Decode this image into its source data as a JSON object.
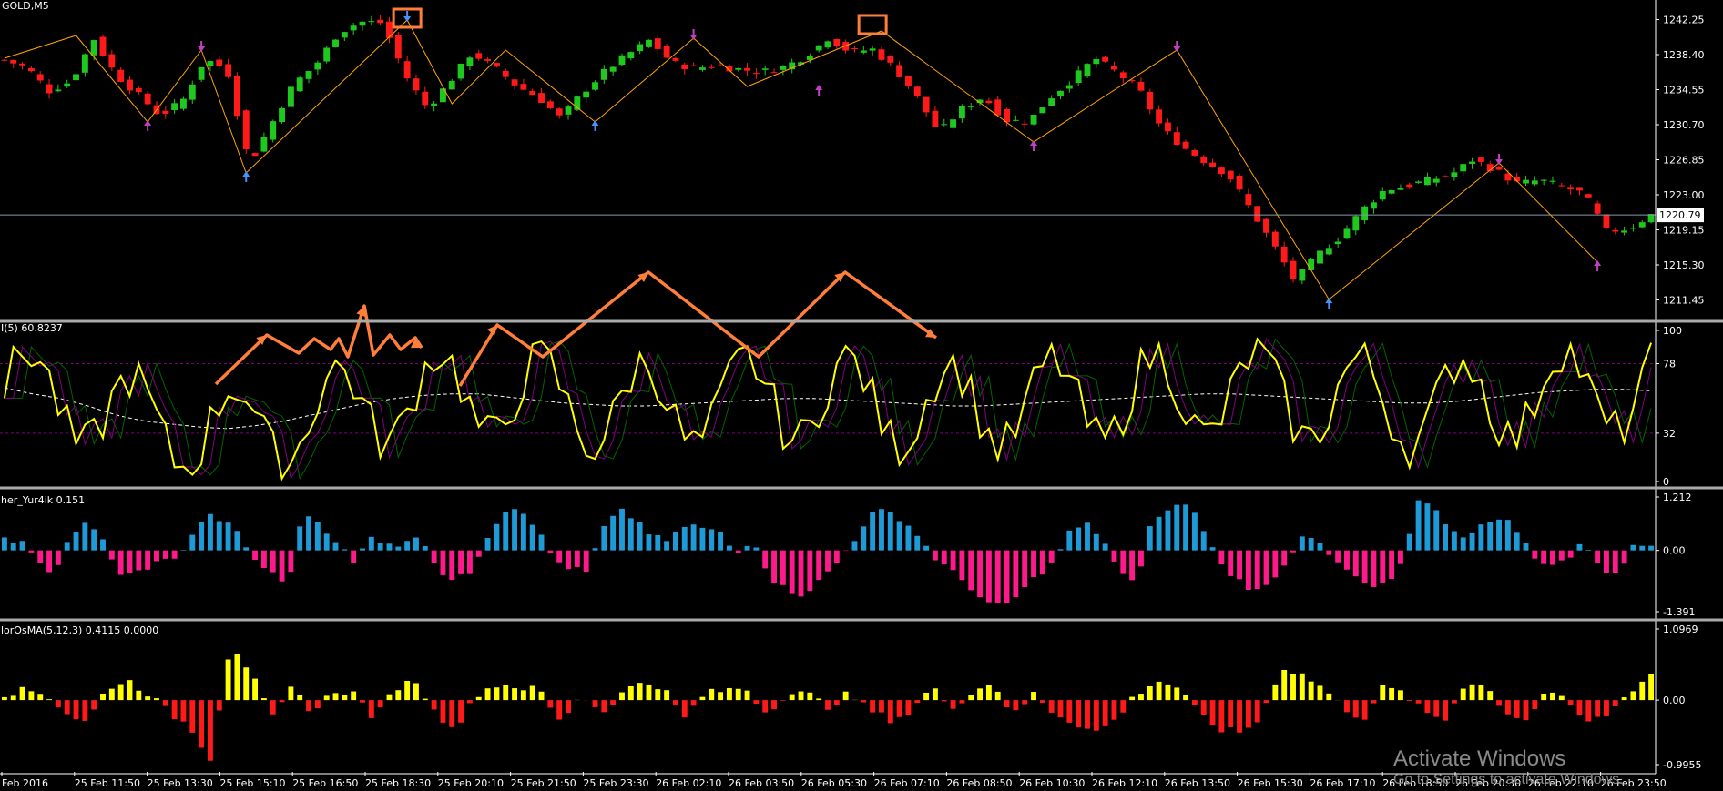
{
  "symbol_label": "GOLD,M5",
  "colors": {
    "background": "#000000",
    "bull": "#1ec81e",
    "bear": "#ff1a1a",
    "zigzag": "#ffa500",
    "rsi_line": "#ffff00",
    "rsi_avg": "#ffffff",
    "fisher_pos": "#1e9bd7",
    "fisher_neg": "#ff1a8c",
    "osma_pos": "#ffff00",
    "osma_neg": "#ff1a1a",
    "arrows": "#ff7f3a",
    "level_line": "#800080"
  },
  "current_price": "1220.79",
  "watermark": {
    "line1": "Activate Windows",
    "line2": "Go to Settings to activate Windows."
  },
  "chart_data": [
    {
      "type": "candlestick",
      "title": "",
      "y_ticks": [
        "1242.25",
        "1238.40",
        "1234.55",
        "1230.70",
        "1226.85",
        "1223.00",
        "1219.15",
        "1215.30",
        "1211.45"
      ],
      "ylim": [
        1209.6,
        1244.0
      ],
      "close_series": [
        1237.8,
        1237.0,
        1234.4,
        1235.5,
        1240.2,
        1236.2,
        1234.0,
        1231.7,
        1233.3,
        1237.9,
        1236.8,
        1226.4,
        1230.8,
        1235.2,
        1237.3,
        1240.8,
        1242.0,
        1241.9,
        1236.2,
        1232.5,
        1235.4,
        1238.6,
        1237.0,
        1235.0,
        1233.7,
        1231.4,
        1234.3,
        1236.6,
        1238.4,
        1240.0,
        1237.5,
        1236.9,
        1237.2,
        1236.8,
        1236.5,
        1237.0,
        1238.2,
        1240.2,
        1238.7,
        1239.0,
        1236.9,
        1233.8,
        1229.8,
        1232.4,
        1233.8,
        1231.2,
        1231.0,
        1233.7,
        1235.7,
        1238.0,
        1236.4,
        1234.5,
        1230.3,
        1228.2,
        1226.6,
        1225.2,
        1221.4,
        1217.6,
        1213.5,
        1216.4,
        1218.3,
        1221.3,
        1223.5,
        1224.0,
        1224.6,
        1225.2,
        1226.9,
        1225.7,
        1224.2,
        1224.6,
        1223.9,
        1223.1,
        1219.0,
        1219.3,
        1220.8
      ],
      "zigzag": [
        [
          0,
          1238.0
        ],
        [
          8,
          1240.5
        ],
        [
          16,
          1231.0
        ],
        [
          22,
          1238.9
        ],
        [
          27,
          1225.4
        ],
        [
          45,
          1242.2
        ],
        [
          50,
          1233.0
        ],
        [
          56,
          1238.9
        ],
        [
          66,
          1231.0
        ],
        [
          77,
          1240.2
        ],
        [
          83,
          1234.9
        ],
        [
          98,
          1241.0
        ],
        [
          115,
          1228.8
        ],
        [
          124,
          1234.5
        ],
        [
          131,
          1238.9
        ],
        [
          148,
          1211.5
        ],
        [
          167,
          1226.5
        ],
        [
          178,
          1215.6
        ]
      ],
      "swing_markers": [
        {
          "i": 16,
          "v": 1231.0,
          "side": "low",
          "color": "#c040c0"
        },
        {
          "i": 22,
          "v": 1238.9,
          "side": "high",
          "color": "#c040c0"
        },
        {
          "i": 27,
          "v": 1225.4,
          "side": "low",
          "color": "#4a90ff"
        },
        {
          "i": 45,
          "v": 1242.2,
          "side": "high",
          "color": "#4a90ff"
        },
        {
          "i": 66,
          "v": 1231.0,
          "side": "low",
          "color": "#4a90ff"
        },
        {
          "i": 77,
          "v": 1240.2,
          "side": "high",
          "color": "#c040c0"
        },
        {
          "i": 91,
          "v": 1234.9,
          "side": "low",
          "color": "#c040c0"
        },
        {
          "i": 115,
          "v": 1228.8,
          "side": "low",
          "color": "#c040c0"
        },
        {
          "i": 131,
          "v": 1238.9,
          "side": "high",
          "color": "#c040c0"
        },
        {
          "i": 148,
          "v": 1211.5,
          "side": "low",
          "color": "#4a90ff"
        },
        {
          "i": 167,
          "v": 1226.5,
          "side": "high",
          "color": "#c040c0"
        },
        {
          "i": 178,
          "v": 1215.6,
          "side": "low",
          "color": "#c040c0"
        }
      ],
      "highlight_boxes": [
        {
          "i": 45,
          "v": 1242.2
        },
        {
          "i": 97,
          "v": 1241.5
        }
      ]
    },
    {
      "type": "line",
      "title": "I(5) 60.8237",
      "y_ticks": [
        "100",
        "78",
        "32",
        "0"
      ],
      "ylim": [
        0,
        100
      ],
      "levels": [
        78,
        32
      ],
      "series": [
        {
          "values": [
            62,
            58,
            55,
            50,
            44,
            40,
            38,
            36,
            35,
            37,
            40,
            44,
            48,
            52,
            55,
            57,
            58,
            58,
            56,
            54,
            52,
            51,
            50,
            50,
            51,
            52,
            53,
            54,
            55,
            55,
            54,
            53,
            52,
            51,
            50,
            50,
            51,
            52,
            53,
            54,
            55,
            56,
            57,
            58,
            58,
            57,
            56,
            55,
            54,
            53,
            52,
            52,
            53,
            55,
            57,
            59,
            60,
            61,
            61,
            60
          ]
        }
      ]
    },
    {
      "type": "bar",
      "title": "her_Yur4ik 0.151",
      "y_ticks": [
        "1.212",
        "0.00",
        "-1.391"
      ],
      "ylim": [
        -1.391,
        1.212
      ],
      "values": [
        0.3,
        0.2,
        -0.3,
        -0.5,
        0.4,
        0.6,
        0.2,
        -0.6,
        -0.5,
        -0.3,
        -0.2,
        0.1,
        0.8,
        0.7,
        0.4,
        -0.2,
        -0.5,
        -0.8,
        0.9,
        0.6,
        0.2,
        -0.3,
        0.3,
        0.2,
        0.1,
        0.4,
        -0.4,
        -0.7,
        -0.5,
        0.3,
        0.9,
        1.0,
        0.5,
        -0.2,
        -0.4,
        -0.5,
        0.5,
        0.9,
        0.7,
        0.3,
        0.2,
        0.6,
        0.5,
        0.4,
        -0.1,
        0.3,
        -0.6,
        -0.9,
        -1.0,
        -0.7,
        -0.3,
        0.2,
        0.8,
        0.9,
        0.7,
        0.3,
        -0.2,
        -0.5,
        -0.8,
        -1.2,
        -1.3,
        -1.0,
        -0.6,
        -0.3,
        0.4,
        0.6,
        0.3,
        -0.5,
        -0.8,
        0.7,
        0.9,
        1.1,
        0.6,
        -0.3,
        -0.6,
        -0.9,
        -0.7,
        -0.4,
        0.3,
        0.2,
        -0.3,
        -0.5,
        -0.9,
        -0.8,
        -0.3,
        1.2,
        0.9,
        0.5,
        0.3,
        0.6,
        0.8,
        0.4,
        -0.2,
        -0.3,
        -0.2,
        0.2,
        -0.4,
        -0.6,
        0.2,
        0.15
      ]
    },
    {
      "type": "bar",
      "title": "lorOsMA(5,12,3) 0.4115 0.0000",
      "y_ticks": [
        "1.0969",
        "0.00",
        "-0.9955"
      ],
      "ylim": [
        -0.9955,
        1.0969
      ],
      "values": [
        0.1,
        0.15,
        0.1,
        -0.2,
        -0.35,
        0.2,
        0.3,
        0.1,
        -0.2,
        -0.4,
        -0.9,
        0.9,
        0.4,
        -0.3,
        0.2,
        -0.2,
        0.15,
        0.1,
        -0.3,
        0.2,
        0.3,
        -0.25,
        -0.4,
        0.1,
        0.25,
        0.2,
        0.15,
        -0.35,
        0.1,
        -0.2,
        0.1,
        0.3,
        0.2,
        -0.3,
        0.1,
        0.15,
        0.2,
        -0.2,
        0.1,
        0.1,
        -0.1,
        0.1,
        -0.15,
        -0.3,
        -0.2,
        0.2,
        -0.1,
        0.1,
        0.3,
        -0.25,
        0.1,
        -0.2,
        -0.35,
        -0.5,
        -0.3,
        0.1,
        0.3,
        0.2,
        -0.2,
        -0.45,
        -0.5,
        -0.3,
        0.5,
        0.4,
        0.2,
        -0.1,
        -0.3,
        0.2,
        0.1,
        -0.2,
        -0.3,
        0.3,
        0.2,
        -0.2,
        -0.3,
        0.2,
        -0.1,
        -0.35,
        -0.2,
        0.15,
        0.4
      ]
    }
  ],
  "x_axis_labels": [
    "Feb 2016",
    "25 Feb 11:50",
    "25 Feb 13:30",
    "25 Feb 15:10",
    "25 Feb 16:50",
    "25 Feb 18:30",
    "25 Feb 20:10",
    "25 Feb 21:50",
    "25 Feb 23:30",
    "26 Feb 02:10",
    "26 Feb 03:50",
    "26 Feb 05:30",
    "26 Feb 07:10",
    "26 Feb 08:50",
    "26 Feb 10:30",
    "26 Feb 12:10",
    "26 Feb 13:50",
    "26 Feb 15:30",
    "26 Feb 17:10",
    "26 Feb 18:50",
    "26 Feb 20:30",
    "26 Feb 22:10",
    "26 Feb 23:50"
  ]
}
